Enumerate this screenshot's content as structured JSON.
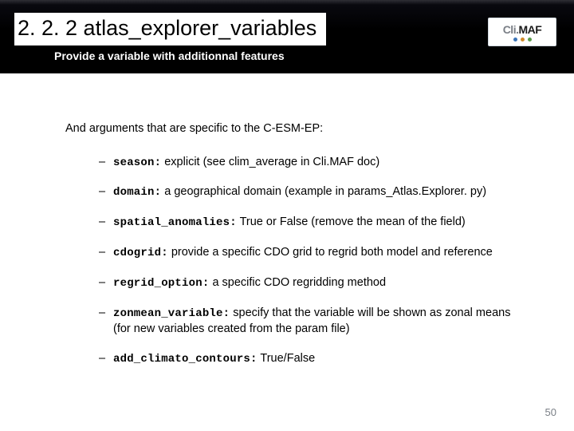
{
  "header": {
    "title": "2. 2. 2 atlas_explorer_variables",
    "subtitle": "Provide a variable with additionnal features",
    "logo": {
      "grey": "Cli.",
      "black": "MAF"
    }
  },
  "content": {
    "intro": "And arguments that are specific to the C-ESM-EP:",
    "items": [
      {
        "key": "season:",
        "desc": " explicit (see clim_average in Cli.MAF doc)"
      },
      {
        "key": "domain:",
        "desc": " a geographical domain (example in params_Atlas.Explorer. py)"
      },
      {
        "key": "spatial_anomalies:",
        "desc": " True or False (remove the mean of the field)"
      },
      {
        "key": "cdogrid:",
        "desc": " provide a specific CDO grid to regrid both model and reference"
      },
      {
        "key": "regrid_option:",
        "desc": " a specific CDO regridding method"
      },
      {
        "key": "zonmean_variable:",
        "desc": " specify that the variable will be shown as zonal means (for new variables created from the param file)"
      },
      {
        "key": "add_climato_contours:",
        "desc": "  True/False"
      }
    ]
  },
  "page_number": "50"
}
